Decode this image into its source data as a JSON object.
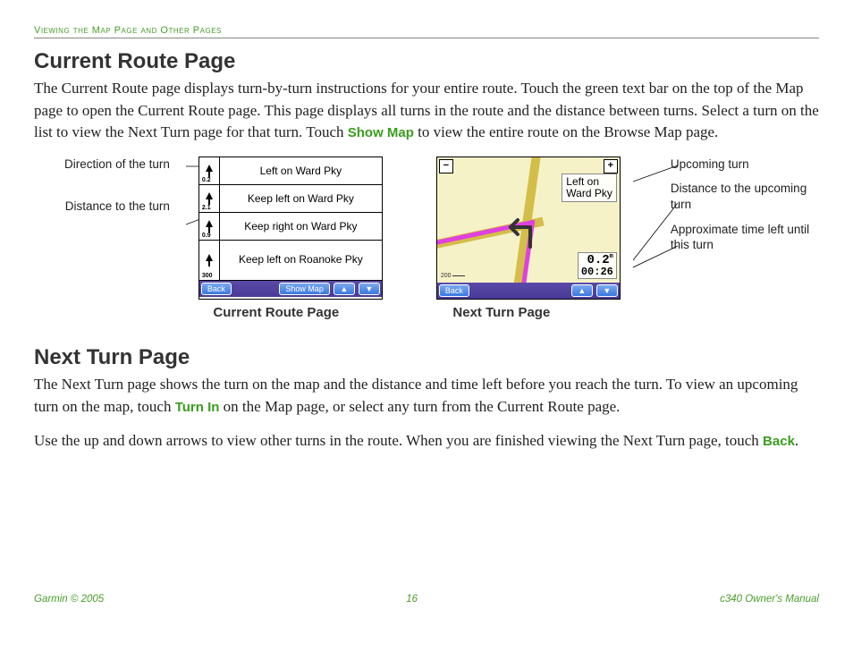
{
  "header": {
    "section_title": "Viewing the Map Page and Other Pages"
  },
  "section1": {
    "heading": "Current Route Page",
    "para1_a": "The Current Route page displays turn-by-turn instructions for your entire route. Touch the green text bar on the top of the Map page to open the Current Route page. This page displays all turns in the route and the distance between turns. Select a turn on the list to view the Next Turn page for that turn. Touch ",
    "para1_link": "Show Map",
    "para1_b": " to view the entire route on the Browse Map page."
  },
  "callouts_left": {
    "c1": "Direction of the turn",
    "c2": "Distance to the turn"
  },
  "callouts_right": {
    "c1": "Upcoming turn",
    "c2": "Distance to the upcoming turn",
    "c3": "Approximate time left until this turn"
  },
  "fig1": {
    "caption": "Current Route Page",
    "rows": [
      {
        "dist": "0.2",
        "text": "Left on Ward Pky"
      },
      {
        "dist": "2.1",
        "text": "Keep left on Ward Pky"
      },
      {
        "dist": "0.9",
        "text": "Keep right on Ward Pky"
      },
      {
        "dist": "300",
        "text": "Keep left on Roanoke Pky"
      }
    ],
    "btn_back": "Back",
    "btn_showmap": "Show Map",
    "btn_up": "▲",
    "btn_down": "▼"
  },
  "fig2": {
    "caption": "Next Turn Page",
    "label_line1": "Left on",
    "label_line2": "Ward Pky",
    "dist": "0.2",
    "time": "00:26",
    "scale": "200",
    "zoom_in": "+",
    "zoom_out": "−",
    "btn_back": "Back",
    "btn_up": "▲",
    "btn_down": "▼"
  },
  "section2": {
    "heading": "Next Turn Page",
    "para1_a": "The Next Turn page shows the turn on the map and the distance and time left before you reach the turn. To view an upcoming turn on the map, touch ",
    "para1_link": "Turn In",
    "para1_b": " on the Map page, or select any turn from the Current Route page.",
    "para2_a": "Use the up and down arrows to view other turns in the route. When you are finished viewing the Next Turn page, touch ",
    "para2_link": "Back",
    "para2_b": "."
  },
  "footer": {
    "left": "Garmin © 2005",
    "center": "16",
    "right": "c340 Owner's Manual"
  }
}
